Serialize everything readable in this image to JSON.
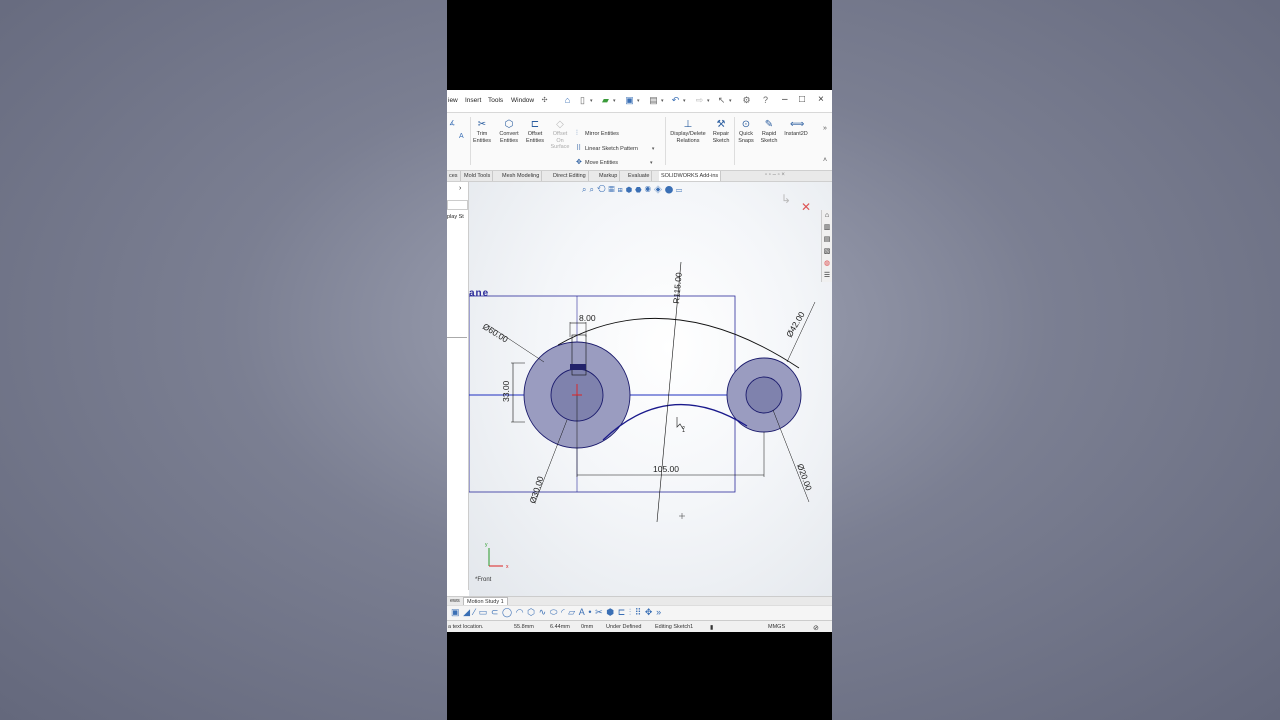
{
  "menu": {
    "items": [
      "iew",
      "Insert",
      "Tools",
      "Window"
    ]
  },
  "commands": {
    "trim": "Trim Entities",
    "convert": "Convert Entities",
    "offset": "Offset Entities",
    "offset_surface": "Offset On Surface",
    "mirror": "Mirror Entities",
    "linear_pattern": "Linear Sketch Pattern",
    "move": "Move Entities",
    "display_delete": "Display/Delete Relations",
    "repair": "Repair Sketch",
    "quick_snaps": "Quick Snaps",
    "rapid_sketch": "Rapid Sketch",
    "instant2d": "Instant2D"
  },
  "tabs": [
    "ces",
    "Mold Tools",
    "Mesh Modeling",
    "Direct Editing",
    "Markup",
    "Evaluate",
    "SOLIDWORKS Add-ins"
  ],
  "left_pane": {
    "label": "play St"
  },
  "viewport": {
    "plane_label": "ane",
    "view_label": "*Front",
    "dimensions": {
      "d_large": "Ø60.00",
      "d_small": "Ø30.00",
      "d_right_large": "Ø42.00",
      "d_right_small": "Ø20.00",
      "width_slot": "8.00",
      "height_slot": "33.00",
      "radius_top": "R115.00",
      "center_distance": "105.00"
    },
    "triad": {
      "x": "x",
      "y": "y"
    }
  },
  "motion_tabs": [
    "ews",
    "Motion Study 1"
  ],
  "status": {
    "message": "a text location.",
    "x": "55.8mm",
    "y": "6.44mm",
    "z": "0mm",
    "state": "Under Defined",
    "editing": "Editing Sketch1",
    "units": "MMGS"
  },
  "colors": {
    "sketch_fill": "#9a9cc0",
    "sketch_line": "#1a1a8c",
    "selection": "#2b2b9a"
  }
}
